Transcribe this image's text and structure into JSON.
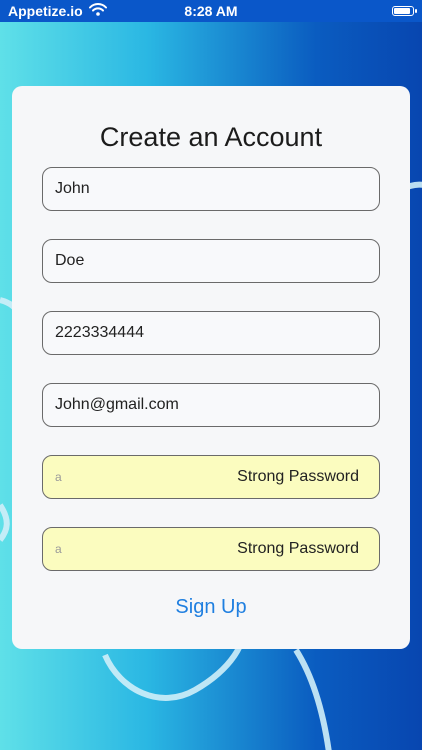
{
  "status_bar": {
    "carrier": "Appetize.io",
    "time": "8:28 AM",
    "icons": {
      "wifi": "wifi-icon",
      "battery": "battery-icon"
    },
    "battery_level_fraction": 0.9
  },
  "form": {
    "title": "Create an Account",
    "fields": [
      {
        "value": "John"
      },
      {
        "value": "Doe"
      },
      {
        "value": "2223334444"
      },
      {
        "value": "John@gmail.com"
      }
    ],
    "password_fields": [
      {
        "masked_value": "a",
        "suggestion": "Strong Password"
      },
      {
        "masked_value": "a",
        "suggestion": "Strong Password"
      }
    ],
    "submit_label": "Sign Up"
  },
  "colors": {
    "accent": "#1f7fe0",
    "autofill_highlight": "#fbfcbf",
    "card_background": "#f6f7f9"
  }
}
